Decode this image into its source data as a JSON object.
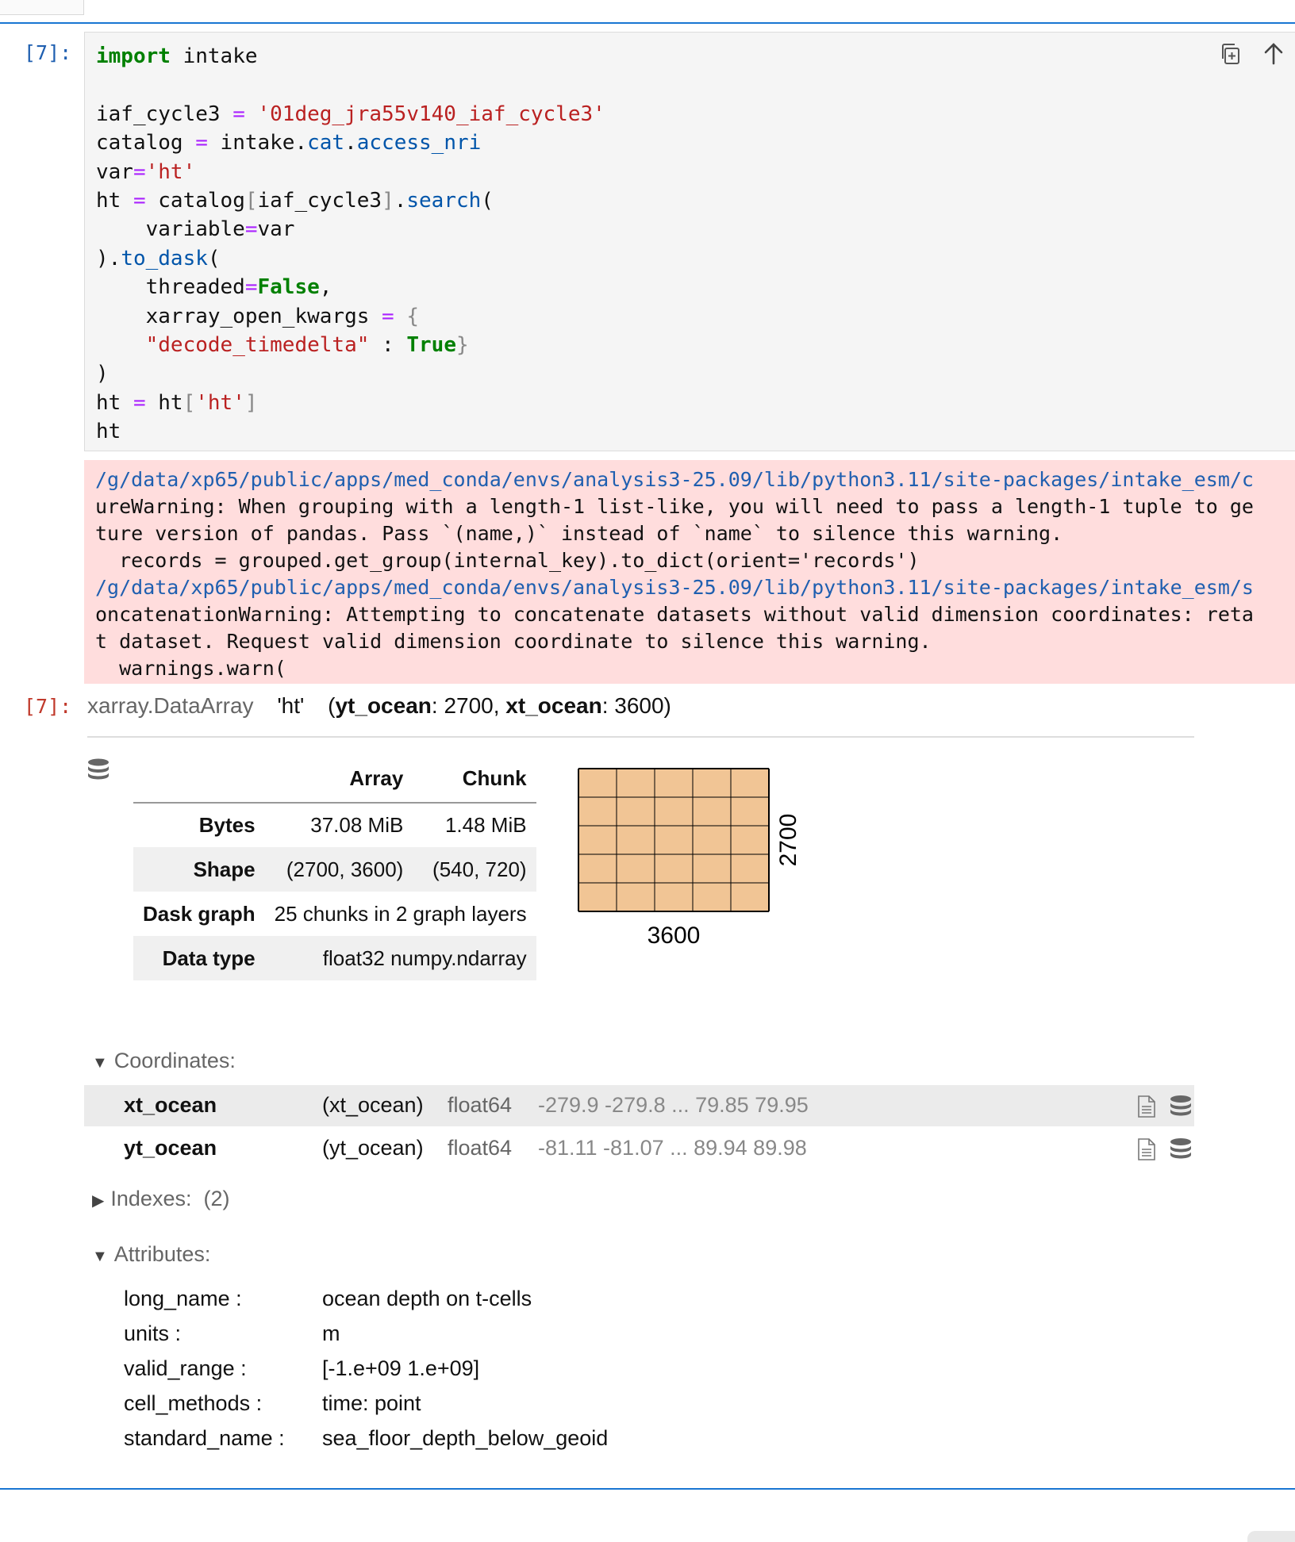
{
  "input_prompt": "[7]:",
  "output_prompt": "[7]:",
  "code_lines": [
    [
      {
        "t": "import",
        "c": "kw"
      },
      {
        "t": " intake"
      }
    ],
    [],
    [
      {
        "t": "iaf_cycle3 "
      },
      {
        "t": "=",
        "c": "op"
      },
      {
        "t": " "
      },
      {
        "t": "'01deg_jra55v140_iaf_cycle3'",
        "c": "str"
      }
    ],
    [
      {
        "t": "catalog "
      },
      {
        "t": "=",
        "c": "op"
      },
      {
        "t": " intake"
      },
      {
        "t": "."
      },
      {
        "t": "cat",
        "c": "attr"
      },
      {
        "t": "."
      },
      {
        "t": "access_nri",
        "c": "attr"
      }
    ],
    [
      {
        "t": "var"
      },
      {
        "t": "=",
        "c": "op"
      },
      {
        "t": "'ht'",
        "c": "str"
      }
    ],
    [
      {
        "t": "ht "
      },
      {
        "t": "=",
        "c": "op"
      },
      {
        "t": " catalog"
      },
      {
        "t": "[",
        "c": "br"
      },
      {
        "t": "iaf_cycle3"
      },
      {
        "t": "]",
        "c": "br"
      },
      {
        "t": "."
      },
      {
        "t": "search",
        "c": "attr"
      },
      {
        "t": "("
      }
    ],
    [
      {
        "t": "    variable"
      },
      {
        "t": "=",
        "c": "op"
      },
      {
        "t": "var"
      }
    ],
    [
      {
        "t": ")"
      },
      {
        "t": "."
      },
      {
        "t": "to_dask",
        "c": "attr"
      },
      {
        "t": "("
      }
    ],
    [
      {
        "t": "    threaded"
      },
      {
        "t": "=",
        "c": "op"
      },
      {
        "t": "False",
        "c": "kw"
      },
      {
        "t": ","
      }
    ],
    [
      {
        "t": "    xarray_open_kwargs "
      },
      {
        "t": "=",
        "c": "op"
      },
      {
        "t": " "
      },
      {
        "t": "{",
        "c": "br"
      }
    ],
    [
      {
        "t": "    "
      },
      {
        "t": "\"decode_timedelta\"",
        "c": "str"
      },
      {
        "t": " : "
      },
      {
        "t": "True",
        "c": "kw"
      },
      {
        "t": "}",
        "c": "br"
      }
    ],
    [
      {
        "t": ")"
      }
    ],
    [
      {
        "t": "ht "
      },
      {
        "t": "=",
        "c": "op"
      },
      {
        "t": " ht"
      },
      {
        "t": "[",
        "c": "br"
      },
      {
        "t": "'ht'",
        "c": "str"
      },
      {
        "t": "]",
        "c": "br"
      }
    ],
    [
      {
        "t": "ht"
      }
    ]
  ],
  "stderr_lines": [
    {
      "text": "/g/data/xp65/public/apps/med_conda/envs/analysis3-25.09/lib/python3.11/site-packages/intake_esm/c",
      "path": true
    },
    {
      "text": "ureWarning: When grouping with a length-1 list-like, you will need to pass a length-1 tuple to ge",
      "path": false
    },
    {
      "text": "ture version of pandas. Pass `(name,)` instead of `name` to silence this warning.",
      "path": false
    },
    {
      "text": "  records = grouped.get_group(internal_key).to_dict(orient='records')",
      "path": false
    },
    {
      "text": "/g/data/xp65/public/apps/med_conda/envs/analysis3-25.09/lib/python3.11/site-packages/intake_esm/s",
      "path": true
    },
    {
      "text": "oncatenationWarning: Attempting to concatenate datasets without valid dimension coordinates: reta",
      "path": false
    },
    {
      "text": "t dataset. Request valid dimension coordinate to silence this warning.",
      "path": false
    },
    {
      "text": "  warnings.warn(",
      "path": false
    }
  ],
  "xarray": {
    "type": "xarray.DataArray",
    "name": "'ht'",
    "dims_open": "(",
    "dim1_name": "yt_ocean",
    "dim1_size": ": 2700, ",
    "dim2_name": "xt_ocean",
    "dim2_size": ": 3600)",
    "dask_table": {
      "header": [
        "",
        "Array",
        "Chunk"
      ],
      "rows": [
        {
          "label": "Bytes",
          "array": "37.08 MiB",
          "chunk": "1.48 MiB"
        },
        {
          "label": "Shape",
          "array": "(2700, 3600)",
          "chunk": "(540, 720)"
        },
        {
          "label": "Dask graph",
          "span": "25 chunks in 2 graph layers"
        },
        {
          "label": "Data type",
          "span": "float32 numpy.ndarray"
        }
      ]
    },
    "chunk_grid": {
      "rows": 5,
      "cols": 5,
      "x_label": "3600",
      "y_label": "2700",
      "fill": "#ecb172"
    },
    "coordinates_title": "Coordinates:",
    "coordinates": [
      {
        "name": "xt_ocean",
        "dims": "(xt_ocean)",
        "dtype": "float64",
        "preview": "-279.9 -279.8 ... 79.85 79.95"
      },
      {
        "name": "yt_ocean",
        "dims": "(yt_ocean)",
        "dtype": "float64",
        "preview": "-81.11 -81.07 ... 89.94 89.98"
      }
    ],
    "indexes_title": "Indexes:",
    "indexes_count": "(2)",
    "attributes_title": "Attributes:",
    "attributes": [
      {
        "key": "long_name :",
        "value": "ocean depth on t-cells"
      },
      {
        "key": "units :",
        "value": "m"
      },
      {
        "key": "valid_range :",
        "value": "[-1.e+09  1.e+09]"
      },
      {
        "key": "cell_methods :",
        "value": "time: point"
      },
      {
        "key": "standard_name :",
        "value": "sea_floor_depth_below_geoid"
      }
    ]
  },
  "icons": {
    "copy": "copy-icon",
    "move_up": "arrow-up-icon",
    "database": "database-icon",
    "file": "file-icon"
  }
}
